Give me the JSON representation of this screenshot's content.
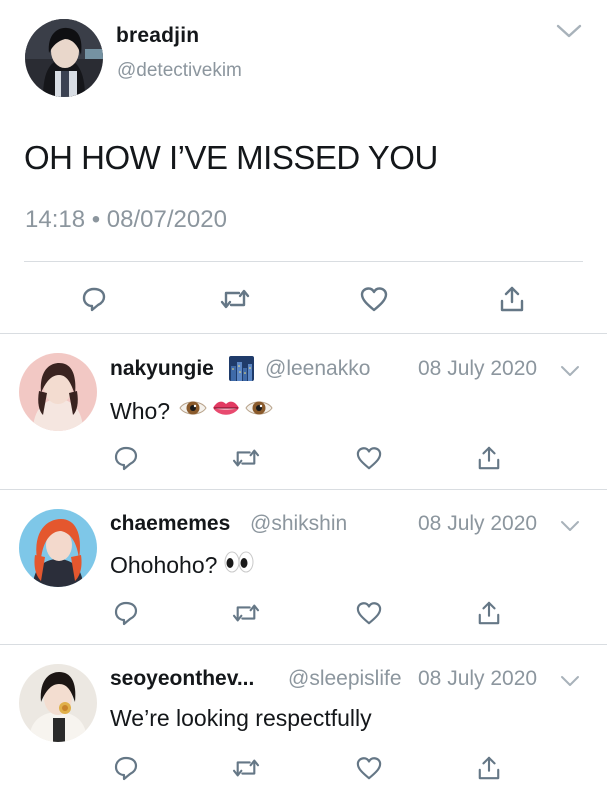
{
  "main_tweet": {
    "display_name": "breadjin",
    "handle": "@detectivekim",
    "text": "OH HOW I’VE MISSED YOU",
    "timestamp": "14:18 • 08/07/2020",
    "avatar_icon": "avatar-photo-icon"
  },
  "actions": {
    "reply_icon": "reply-icon",
    "retweet_icon": "retweet-icon",
    "like_icon": "heart-icon",
    "share_icon": "share-icon"
  },
  "replies": [
    {
      "display_name": "nakyungie",
      "name_badge": "city-night-emoji",
      "handle": "@leenakko",
      "date": "08 July 2020",
      "text": "Who?",
      "emojis": [
        "eye-emoji",
        "lips-emoji",
        "eye-emoji"
      ]
    },
    {
      "display_name": "chaememes",
      "handle": "@shikshin",
      "date": "08 July 2020",
      "text": "Ohohoho?",
      "emojis": [
        "eyes-emoji"
      ]
    },
    {
      "display_name": "seoyeonthev...",
      "handle": "@sleepislife",
      "date": "08 July 2020",
      "text": "We’re looking respectfully",
      "emojis": []
    }
  ],
  "colors": {
    "text_primary": "#14171a",
    "text_secondary": "#8c969e",
    "icon_gray": "#657786",
    "divider": "#d9dde1"
  }
}
